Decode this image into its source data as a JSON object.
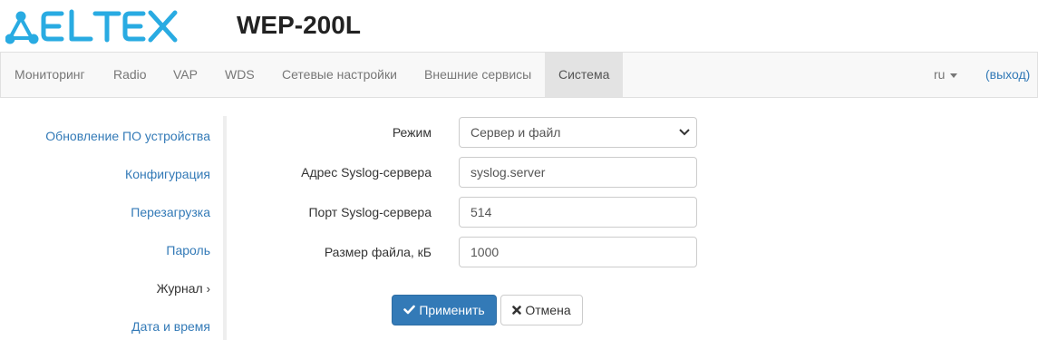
{
  "header": {
    "logo_text": "ELTEX",
    "model": "WEP-200L"
  },
  "nav": {
    "items": [
      {
        "label": "Мониторинг"
      },
      {
        "label": "Radio"
      },
      {
        "label": "VAP"
      },
      {
        "label": "WDS"
      },
      {
        "label": "Сетевые настройки"
      },
      {
        "label": "Внешние сервисы"
      },
      {
        "label": "Система",
        "active": true
      }
    ],
    "language": "ru",
    "logout": "(выход)"
  },
  "sidebar": {
    "items": [
      {
        "label": "Обновление ПО устройства"
      },
      {
        "label": "Конфигурация"
      },
      {
        "label": "Перезагрузка"
      },
      {
        "label": "Пароль"
      },
      {
        "label": "Журнал",
        "active": true,
        "arrow": "›"
      },
      {
        "label": "Дата и время"
      }
    ]
  },
  "form": {
    "mode_label": "Режим",
    "mode_value": "Сервер и файл",
    "syslog_address_label": "Адрес Syslog-сервера",
    "syslog_address_value": "syslog.server",
    "syslog_port_label": "Порт Syslog-сервера",
    "syslog_port_value": "514",
    "file_size_label": "Размер файла, кБ",
    "file_size_value": "1000"
  },
  "actions": {
    "apply_label": "Применить",
    "cancel_label": "Отмена"
  },
  "icons": {
    "apply": "check-icon",
    "cancel": "close-icon",
    "select": "chevron-down-icon"
  },
  "colors": {
    "accent": "#337ab7",
    "logo": "#29abe2",
    "nav_bg": "#f8f8f8",
    "nav_active_bg": "#e3e3e3"
  }
}
